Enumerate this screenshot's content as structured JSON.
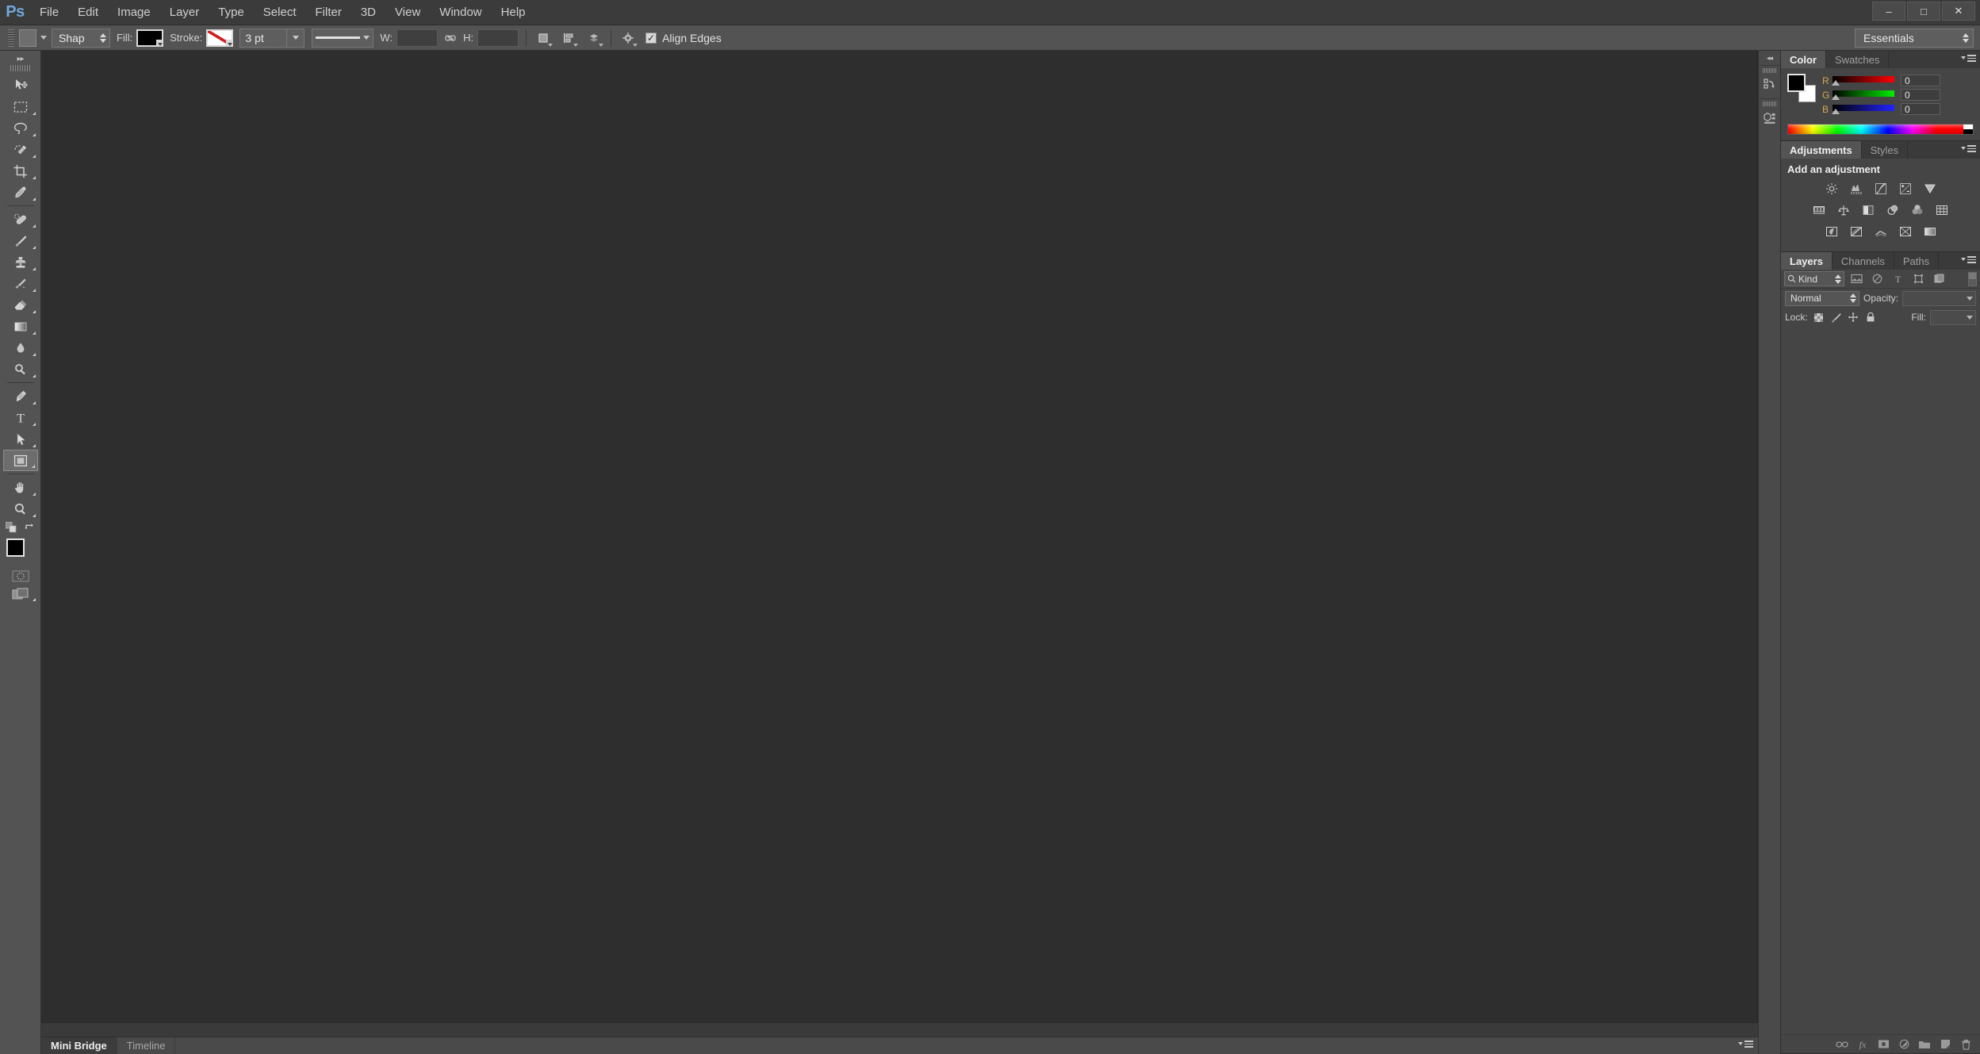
{
  "app": {
    "logo": "Ps",
    "menus": [
      "File",
      "Edit",
      "Image",
      "Layer",
      "Type",
      "Select",
      "Filter",
      "3D",
      "View",
      "Window",
      "Help"
    ],
    "window_controls": [
      {
        "name": "minimize",
        "glyph": "–"
      },
      {
        "name": "maximize",
        "glyph": "□"
      },
      {
        "name": "close",
        "glyph": "✕"
      }
    ]
  },
  "options_bar": {
    "tool_preset_label": "tool-preset-picker",
    "shape_mode": "Shap",
    "fill_label": "Fill:",
    "fill_color": "#000000",
    "stroke_label": "Stroke:",
    "stroke_color": "none",
    "stroke_width": "3 pt",
    "stroke_style": "solid-line",
    "w_label": "W:",
    "w_value": "",
    "link_icon": "link-icon",
    "h_label": "H:",
    "h_value": "",
    "path_operations_icon": "path-operations-icon",
    "path_alignment_icon": "path-alignment-icon",
    "path_arrangement_icon": "path-arrangement-icon",
    "settings_icon": "gear-icon",
    "align_edges_label": "Align Edges",
    "align_edges_checked": true,
    "align_edges_glyph": "✓",
    "workspace": "Essentials"
  },
  "toolbar": {
    "tools": [
      {
        "name": "move-tool",
        "has_submenu": false
      },
      {
        "name": "rectangular-marquee-tool",
        "has_submenu": true
      },
      {
        "name": "lasso-tool",
        "has_submenu": true
      },
      {
        "name": "quick-selection-tool",
        "has_submenu": true
      },
      {
        "name": "crop-tool",
        "has_submenu": true
      },
      {
        "name": "eyedropper-tool",
        "has_submenu": true
      },
      {
        "name": "spot-healing-brush-tool",
        "has_submenu": true
      },
      {
        "name": "brush-tool",
        "has_submenu": true
      },
      {
        "name": "clone-stamp-tool",
        "has_submenu": true
      },
      {
        "name": "history-brush-tool",
        "has_submenu": true
      },
      {
        "name": "eraser-tool",
        "has_submenu": true
      },
      {
        "name": "gradient-tool",
        "has_submenu": true
      },
      {
        "name": "blur-tool",
        "has_submenu": true
      },
      {
        "name": "dodge-tool",
        "has_submenu": true
      },
      {
        "name": "pen-tool",
        "has_submenu": true
      },
      {
        "name": "horizontal-type-tool",
        "has_submenu": true
      },
      {
        "name": "path-selection-tool",
        "has_submenu": true
      },
      {
        "name": "rectangle-tool",
        "has_submenu": true,
        "active": true
      },
      {
        "name": "hand-tool",
        "has_submenu": true
      },
      {
        "name": "zoom-tool",
        "has_submenu": false
      }
    ],
    "foreground_color": "#000000",
    "background_color": "#ffffff",
    "default_colors_icon": "default-colors-icon",
    "swap_colors_icon": "swap-colors-icon",
    "quick_mask_icon": "quick-mask-icon",
    "screen_mode_icon": "screen-mode-icon"
  },
  "mini_dock": {
    "collapse_glyph": "◂◂",
    "items": [
      {
        "name": "history-panel-icon"
      },
      {
        "name": "properties-3d-panel-icon"
      }
    ]
  },
  "color_panel": {
    "tabs": [
      {
        "label": "Color",
        "active": true
      },
      {
        "label": "Swatches",
        "active": false
      }
    ],
    "foreground_color": "#000000",
    "background_color": "#ffffff",
    "channels": [
      {
        "label": "R",
        "value": "0"
      },
      {
        "label": "G",
        "value": "0"
      },
      {
        "label": "B",
        "value": "0"
      }
    ]
  },
  "adjustments_panel": {
    "tabs": [
      {
        "label": "Adjustments",
        "active": true
      },
      {
        "label": "Styles",
        "active": false
      }
    ],
    "title": "Add an adjustment",
    "rows": [
      [
        {
          "name": "brightness-contrast-icon"
        },
        {
          "name": "levels-icon"
        },
        {
          "name": "curves-icon"
        },
        {
          "name": "exposure-icon"
        },
        {
          "name": "vibrance-icon"
        }
      ],
      [
        {
          "name": "hue-saturation-icon"
        },
        {
          "name": "color-balance-icon"
        },
        {
          "name": "black-white-icon"
        },
        {
          "name": "photo-filter-icon"
        },
        {
          "name": "channel-mixer-icon"
        },
        {
          "name": "color-lookup-icon"
        }
      ],
      [
        {
          "name": "invert-icon"
        },
        {
          "name": "posterize-icon"
        },
        {
          "name": "threshold-icon"
        },
        {
          "name": "selective-color-icon"
        },
        {
          "name": "gradient-map-icon"
        }
      ]
    ]
  },
  "layers_panel": {
    "tabs": [
      {
        "label": "Layers",
        "active": true
      },
      {
        "label": "Channels",
        "active": false
      },
      {
        "label": "Paths",
        "active": false
      }
    ],
    "filter": {
      "search_icon": "search-icon",
      "kind_label": "Kind",
      "type_icons": [
        {
          "name": "filter-pixel-icon"
        },
        {
          "name": "filter-adjustment-icon"
        },
        {
          "name": "filter-type-icon"
        },
        {
          "name": "filter-shape-icon"
        },
        {
          "name": "filter-smart-object-icon"
        }
      ],
      "toggle_name": "filter-enable-toggle"
    },
    "blend_mode": "Normal",
    "opacity_label": "Opacity:",
    "opacity_value": "",
    "lock_label": "Lock:",
    "lock_icons": [
      {
        "name": "lock-transparent-pixels-icon"
      },
      {
        "name": "lock-image-pixels-icon"
      },
      {
        "name": "lock-position-icon"
      },
      {
        "name": "lock-all-icon"
      }
    ],
    "fill_label": "Fill:",
    "fill_value": "",
    "bottom_buttons": [
      {
        "name": "link-layers-button",
        "glyph": "link"
      },
      {
        "name": "layer-style-button",
        "glyph": "fx"
      },
      {
        "name": "add-layer-mask-button",
        "glyph": "mask"
      },
      {
        "name": "new-adjustment-layer-button",
        "glyph": "adjust"
      },
      {
        "name": "new-group-button",
        "glyph": "folder"
      },
      {
        "name": "new-layer-button",
        "glyph": "page"
      },
      {
        "name": "delete-layer-button",
        "glyph": "trash"
      }
    ]
  },
  "bottom_tabs": {
    "tabs": [
      {
        "label": "Mini Bridge",
        "active": true
      },
      {
        "label": "Timeline",
        "active": false
      }
    ]
  },
  "colors": {
    "accent": "#6fa8dc",
    "panel_bg": "#454545",
    "chrome_bg": "#535353",
    "canvas_bg": "#2e2e2e",
    "title_bg": "#3b3b3b",
    "label_orange": "#d6a84a"
  }
}
